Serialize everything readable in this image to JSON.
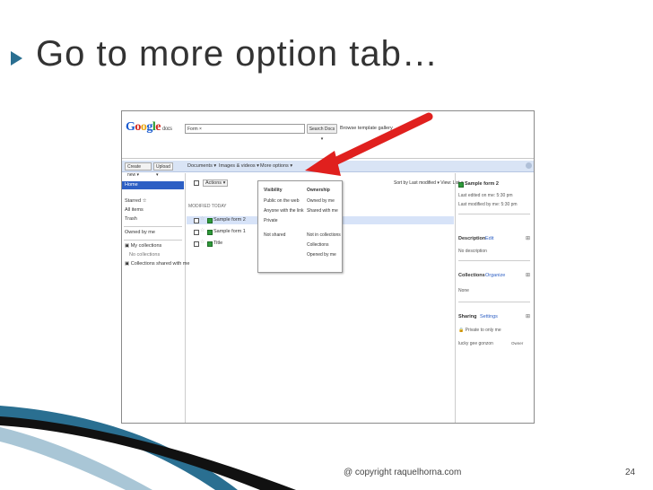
{
  "slide": {
    "title": "Go to more option tab…",
    "footer": "@ copyright raquelhorna.com",
    "page_number": "24",
    "accent_color": "#2a6f91",
    "arrow_color": "#e0201e"
  },
  "app": {
    "logo": {
      "G": "G",
      "o1": "o",
      "o2": "o",
      "g": "g",
      "l": "l",
      "e": "e",
      "docs": "docs"
    },
    "search_value": "Form ×",
    "search_button": "Search Docs ▾",
    "browse_link": "Browse template gallery",
    "toolbar": {
      "create_new": "Create new ▾",
      "upload": "Upload ▾",
      "documents": "Documents ▾",
      "images_videos": "Images & videos ▾",
      "more_options": "More options ▾",
      "sort": "Sort by Last modified ▾  View: List ▾"
    },
    "sidebar": {
      "home": "Home",
      "starred": "Starred ☆",
      "all_items": "All items",
      "trash": "Trash",
      "owned_by_me": "Owned by me",
      "my_collections": "▣ My collections",
      "no_collections": "No collections",
      "collections_shared": "▣ Collections shared with me"
    },
    "list": {
      "actions": "Actions ▾",
      "section": "MODIFIED TODAY",
      "rows": [
        "Sample form 2",
        "Sample form 1",
        "Title"
      ]
    },
    "dropdown": {
      "visibility_header": "Visibility",
      "ownership_header": "Ownership",
      "visibility": [
        "Public on the web",
        "Anyone with the link",
        "Private",
        "Not shared"
      ],
      "ownership": [
        "Owned by me",
        "Shared with me"
      ],
      "collections": [
        "Not in collections",
        "Collections",
        "Opened by me"
      ]
    },
    "details": {
      "title": "Sample form 2",
      "modified_line1": "Last edited on me: 5:30 pm",
      "modified_line2": "Last modified by me: 5:30 pm",
      "description_label": "Description",
      "description_link": "Edit",
      "description_value": "No description",
      "collections_label": "Collections",
      "collections_link": "Organize",
      "collections_value": "None",
      "sharing_label": "Sharing",
      "sharing_link": "Settings",
      "sharing_line1": "🔒 Private to only me",
      "sharing_user": "lucky gee gonzon",
      "sharing_role": "Owner",
      "plus": "⊞"
    }
  }
}
